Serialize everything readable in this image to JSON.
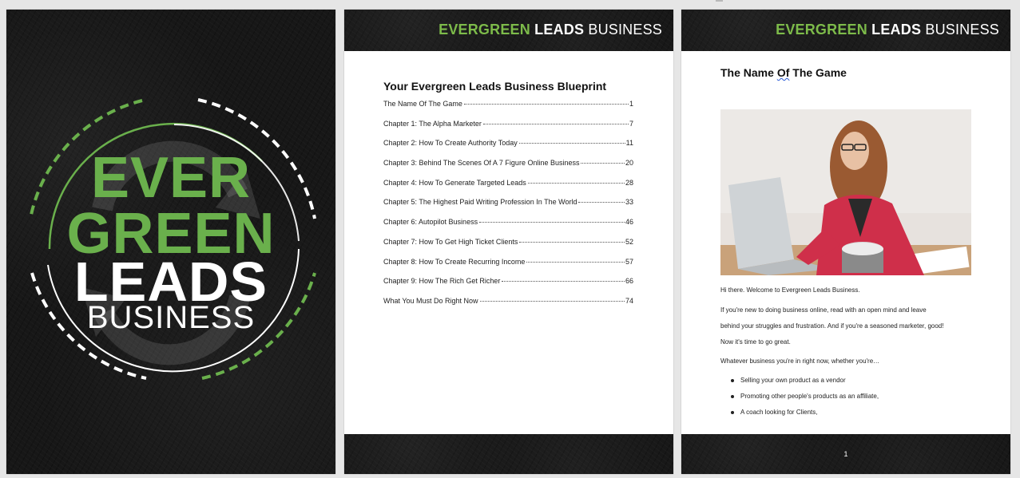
{
  "cover": {
    "title_line1": "EVER",
    "title_line2": "GREEN",
    "title_line3": "LEADS",
    "title_line4": "BUSINESS",
    "accent_color": "#6ab04c"
  },
  "header": {
    "brand_part1": "EVERGREEN",
    "brand_part2": "LEADS",
    "brand_part3": "BUSINESS"
  },
  "toc": {
    "heading": "Your Evergreen Leads Business Blueprint",
    "entries": [
      {
        "label": "The Name Of The Game",
        "page": "1"
      },
      {
        "label": "Chapter 1: The Alpha Marketer",
        "page": "7"
      },
      {
        "label": "Chapter 2: How To Create Authority Today",
        "page": "11"
      },
      {
        "label": "Chapter 3: Behind The Scenes Of A 7 Figure Online Business",
        "page": "20"
      },
      {
        "label": "Chapter 4: How To Generate Targeted Leads",
        "page": "28"
      },
      {
        "label": "Chapter 5: The Highest Paid Writing Profession In The World",
        "page": "33"
      },
      {
        "label": "Chapter 6: Autopilot Business",
        "page": "46"
      },
      {
        "label": "Chapter 7: How To Get High Ticket Clients",
        "page": "52"
      },
      {
        "label": "Chapter 8: How To Create Recurring Income",
        "page": "57"
      },
      {
        "label": "Chapter 9: How The Rich Get Richer",
        "page": "66"
      },
      {
        "label": "What You Must Do Right Now",
        "page": "74"
      }
    ]
  },
  "content": {
    "heading_before": "The Name ",
    "heading_squiggle": "Of",
    "heading_after": " The Game",
    "para1": "Hi there. Welcome to Evergreen Leads Business.",
    "para2_line1": "If you're new to doing business online, read with an open mind and leave",
    "para2_line2": "behind your struggles and frustration. And if you're a seasoned marketer, good!",
    "para2_line3": "Now it's time to go great.",
    "para3": "Whatever business you're in right now, whether you're…",
    "bullets": [
      "Selling your own product as a vendor",
      "Promoting other people's products as an affiliate,",
      "A coach looking for Clients,"
    ],
    "page_number": "1"
  }
}
